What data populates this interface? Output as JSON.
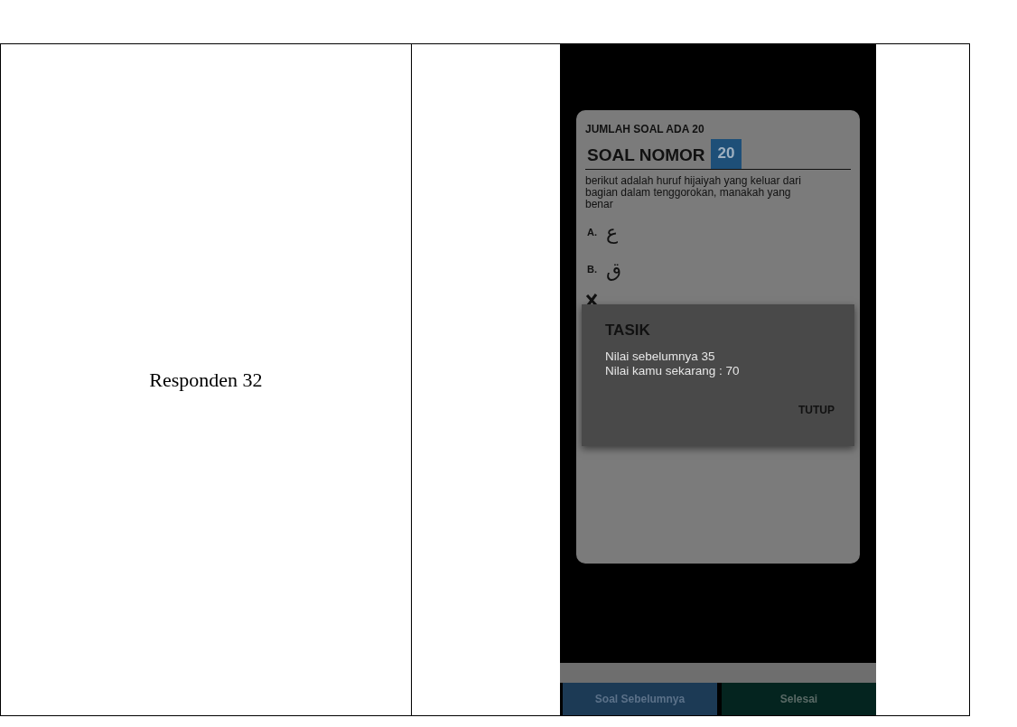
{
  "table": {
    "rows": [
      {
        "label": "Responden 32",
        "screenshot": {
          "quiz": {
            "total_label": "JUMLAH SOAL ADA 20",
            "question_label": "SOAL NOMOR",
            "question_number": "20",
            "question_text": "berikut adalah huruf hijaiyah yang keluar dari bagian dalam tenggorokan, manakah yang benar",
            "options": [
              {
                "letter": "A.",
                "answer": "ع"
              },
              {
                "letter": "B.",
                "answer": "ق"
              }
            ]
          },
          "dialog": {
            "title": "TASIK",
            "lines": [
              "Nilai sebelumnya 35",
              "Nilai kamu sekarang : 70"
            ],
            "button": "TUTUP"
          },
          "buttons": [
            {
              "label": "Soal Sebelumnya",
              "kind": "previous"
            },
            {
              "label": "Selesai",
              "kind": "finish"
            }
          ]
        }
      }
    ]
  }
}
